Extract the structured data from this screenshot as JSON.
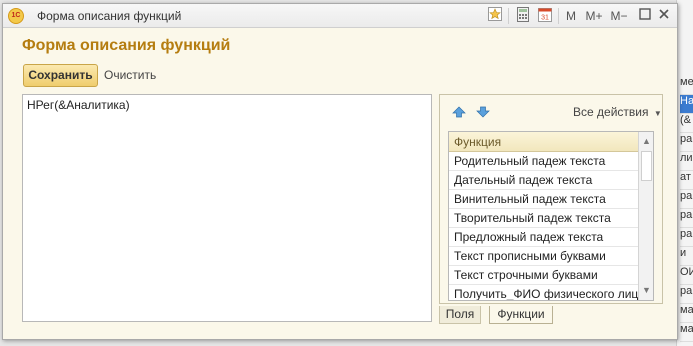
{
  "background": {
    "cells": [
      "ме",
      "На",
      "(&",
      "ра",
      "ли",
      "ат",
      "ра",
      "ра",
      "ра",
      "и",
      "ОИ",
      "ра",
      "ма",
      "ма"
    ]
  },
  "window": {
    "title": "Форма описания функций",
    "toolbar": {
      "memory": "M",
      "memory_plus": "M+",
      "memory_minus": "M−"
    }
  },
  "form": {
    "title": "Форма описания функций",
    "save_label": "Сохранить",
    "clear_label": "Очистить",
    "editor_text": "НРег(&Аналитика)"
  },
  "functions_panel": {
    "all_actions": "Все действия",
    "column_header": "Функция",
    "rows": [
      "Родительный падеж текста",
      "Дательный падеж текста",
      "Винительный падеж текста",
      "Творительный падеж текста",
      "Предложный падеж текста",
      "Текст прописными буквами",
      "Текст строчными буквами",
      "Получить_ФИО физического лица..."
    ]
  },
  "tabs": [
    "Поля",
    "Функции"
  ],
  "colors": {
    "accent": "#b57d10",
    "selection": "#3b7bd0",
    "save_button": "#efcd6d"
  }
}
